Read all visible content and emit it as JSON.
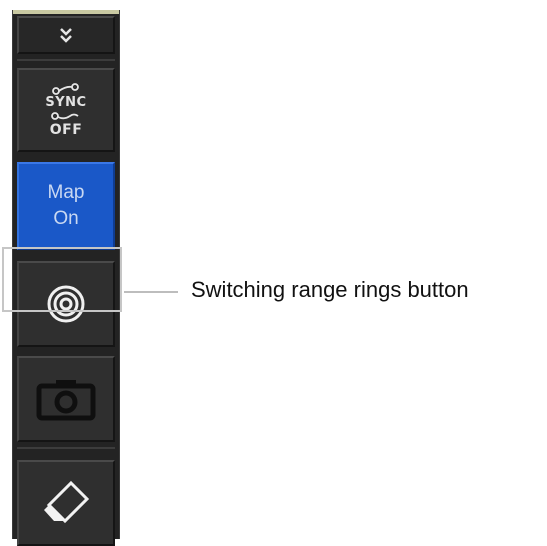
{
  "toolbar": {
    "collapse_icon": "double-chevron-down-icon",
    "sync_button": {
      "icon": "link-nodes-icon",
      "label_top": "SYNC",
      "label_bottom": "OFF"
    },
    "map_button": {
      "line1": "Map",
      "line2": "On",
      "active_color": "#1a58c8"
    },
    "range_rings_button": {
      "icon": "range-rings-icon"
    },
    "camera_button": {
      "icon": "camera-icon"
    },
    "eraser_button": {
      "icon": "eraser-icon"
    }
  },
  "callout": {
    "text": "Switching range rings button"
  },
  "colors": {
    "toolbar_bg": "#232323",
    "highlight": "#c6c6c6"
  }
}
